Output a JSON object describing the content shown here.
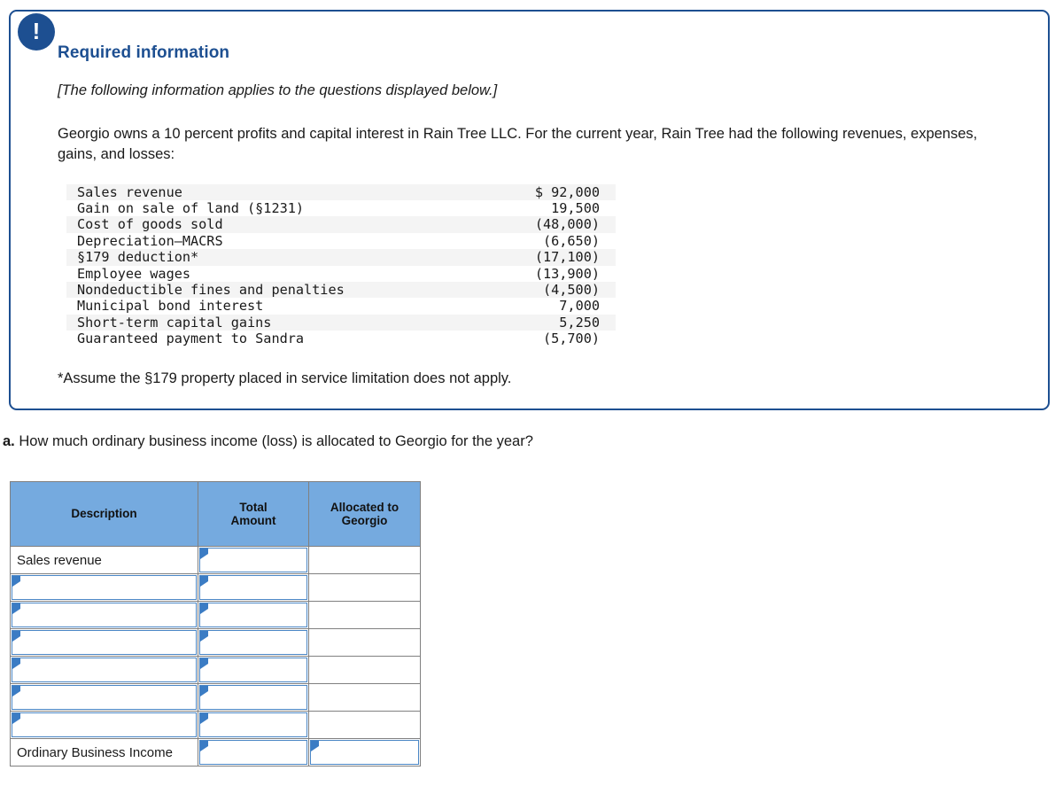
{
  "callout": {
    "icon": "exclamation-icon",
    "heading": "Required information",
    "applies_note": "[The following information applies to the questions displayed below.]",
    "scenario": "Georgio owns a 10 percent profits and capital interest in Rain Tree LLC. For the current year, Rain Tree had the following revenues, expenses, gains, and losses:",
    "footnote": "*Assume the §179 property placed in service limitation does not apply.",
    "border_color": "#1d4f91",
    "badge_color": "#1d4f91"
  },
  "figures": {
    "rows": [
      {
        "label": "Sales revenue",
        "amount": "$ 92,000"
      },
      {
        "label": "Gain on sale of land (§1231)",
        "amount": "19,500"
      },
      {
        "label": "Cost of goods sold",
        "amount": "(48,000)"
      },
      {
        "label": "Depreciation—MACRS",
        "amount": "(6,650)"
      },
      {
        "label": "§179 deduction*",
        "amount": "(17,100)"
      },
      {
        "label": "Employee wages",
        "amount": "(13,900)"
      },
      {
        "label": "Nondeductible fines and penalties",
        "amount": "(4,500)"
      },
      {
        "label": "Municipal bond interest",
        "amount": "7,000"
      },
      {
        "label": "Short-term capital gains",
        "amount": "5,250"
      },
      {
        "label": "Guaranteed payment to Sandra",
        "amount": "(5,700)"
      }
    ]
  },
  "question": {
    "label": "a.",
    "text": "How much ordinary business income (loss) is allocated to Georgio for the year?"
  },
  "answer_table": {
    "header_color": "#75aadf",
    "columns": [
      {
        "label": "Description"
      },
      {
        "label": "Total\nAmount",
        "line1": "Total",
        "line2": "Amount"
      },
      {
        "label": "Allocated to\nGeorgio",
        "line1": "Allocated to",
        "line2": "Georgio"
      }
    ],
    "rows": [
      {
        "description": "Sales revenue",
        "description_editable": false,
        "total": "",
        "allocated": "",
        "total_editable": true,
        "allocated_editable": false,
        "emphasis": false
      },
      {
        "description": "",
        "description_editable": true,
        "total": "",
        "allocated": "",
        "total_editable": true,
        "allocated_editable": false,
        "emphasis": false
      },
      {
        "description": "",
        "description_editable": true,
        "total": "",
        "allocated": "",
        "total_editable": true,
        "allocated_editable": false,
        "emphasis": false
      },
      {
        "description": "",
        "description_editable": true,
        "total": "",
        "allocated": "",
        "total_editable": true,
        "allocated_editable": false,
        "emphasis": false
      },
      {
        "description": "",
        "description_editable": true,
        "total": "",
        "allocated": "",
        "total_editable": true,
        "allocated_editable": false,
        "emphasis": false
      },
      {
        "description": "",
        "description_editable": true,
        "total": "",
        "allocated": "",
        "total_editable": true,
        "allocated_editable": false,
        "emphasis": false
      },
      {
        "description": "",
        "description_editable": true,
        "total": "",
        "allocated": "",
        "total_editable": true,
        "allocated_editable": false,
        "emphasis": false
      },
      {
        "description": "Ordinary Business Income",
        "description_editable": false,
        "total": "",
        "allocated": "",
        "total_editable": true,
        "allocated_editable": true,
        "emphasis": true
      }
    ]
  }
}
